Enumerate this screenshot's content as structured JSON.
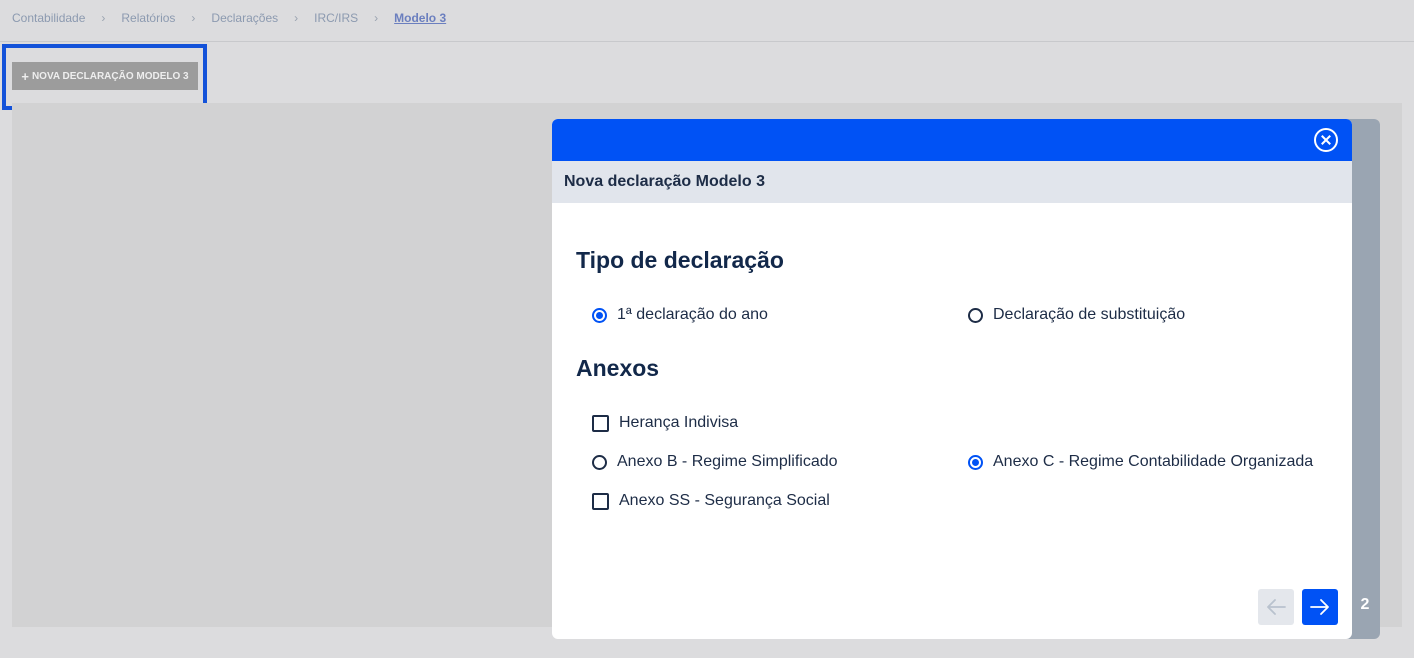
{
  "breadcrumb": {
    "items": [
      "Contabilidade",
      "Relatórios",
      "Declarações",
      "IRC/IRS"
    ],
    "current": "Modelo 3"
  },
  "toolbar": {
    "new_button_icon": "plus-icon",
    "new_button_label": "NOVA DECLARAÇÃO MODELO 3"
  },
  "modal": {
    "subheader_title": "Nova declaração Modelo 3",
    "close_icon": "close-circle-icon",
    "tipo": {
      "title": "Tipo de declaração",
      "options": [
        {
          "label": "1ª declaração do ano",
          "checked": true
        },
        {
          "label": "Declaração de substituição",
          "checked": false
        }
      ]
    },
    "anexos": {
      "title": "Anexos",
      "heranca": {
        "label": "Herança Indivisa",
        "checked": false
      },
      "anexo_b": {
        "label": "Anexo B - Regime Simplificado",
        "checked": false
      },
      "anexo_c": {
        "label": "Anexo C - Regime Contabilidade Organizada",
        "checked": true
      },
      "anexo_ss": {
        "label": "Anexo SS - Segurança Social",
        "checked": false
      }
    },
    "footer": {
      "prev_icon": "arrow-left-icon",
      "next_icon": "arrow-right-icon",
      "step_number": "2"
    }
  },
  "colors": {
    "primary": "#0052f5",
    "highlight": "#1352d9",
    "text_dark": "#1d2c46",
    "subheader_bg": "#e1e5ec"
  }
}
